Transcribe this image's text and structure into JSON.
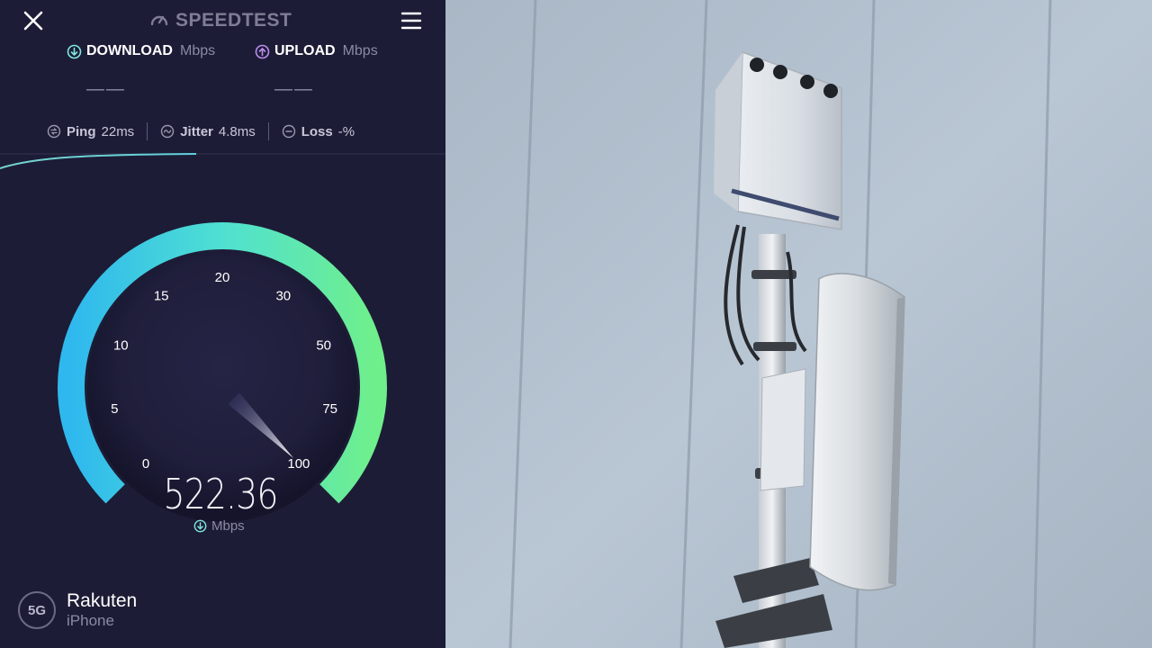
{
  "app": {
    "title": "SPEEDTEST"
  },
  "toolbar": {
    "close_icon": "close-icon",
    "menu_icon": "hamburger-menu-icon"
  },
  "metrics": {
    "download": {
      "label": "DOWNLOAD",
      "unit": "Mbps",
      "value": "——"
    },
    "upload": {
      "label": "UPLOAD",
      "unit": "Mbps",
      "value": "——"
    }
  },
  "stats": {
    "ping": {
      "label": "Ping",
      "value": "22",
      "unit": "ms"
    },
    "jitter": {
      "label": "Jitter",
      "value": "4.8",
      "unit": "ms"
    },
    "loss": {
      "label": "Loss",
      "value": "-",
      "unit": "%"
    }
  },
  "gauge": {
    "ticks": [
      "0",
      "5",
      "10",
      "15",
      "20",
      "30",
      "50",
      "75",
      "100"
    ],
    "reading": "522.36",
    "reading_unit": "Mbps",
    "colors": {
      "start": "#2fb8ee",
      "end": "#6fef8c"
    }
  },
  "provider": {
    "badge": "5G",
    "name": "Rakuten",
    "device": "iPhone"
  },
  "colors": {
    "panel_bg": "#1d1c36",
    "download_accent": "#7fe7de",
    "upload_accent": "#b98ef0"
  }
}
